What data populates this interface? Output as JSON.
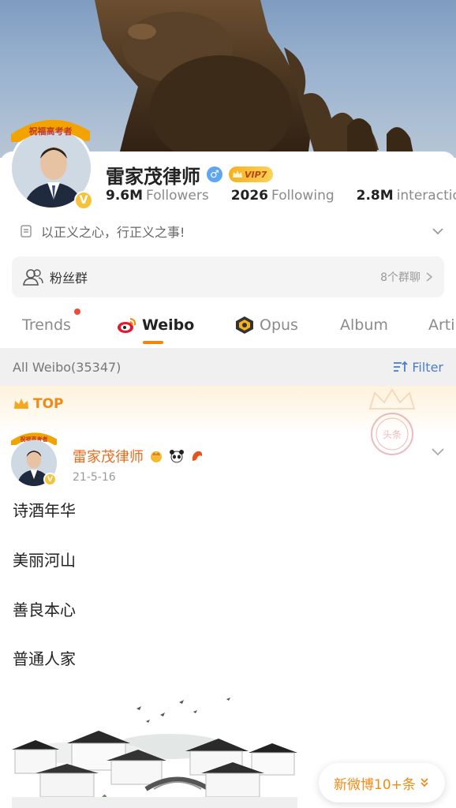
{
  "profile": {
    "name": "雷家茂律师",
    "gender_symbol": "♂",
    "vip_label": "VIP7",
    "verified_badge": "V",
    "avatar_frame_text": "祝福高考者",
    "followers_count": "9.6M",
    "followers_label": "Followers",
    "following_count": "2026",
    "following_label": "Following",
    "interactions_count": "2.8M",
    "interactions_label": "interaction",
    "bio": "以正义之心，行正义之事!"
  },
  "fans_group": {
    "label": "粉丝群",
    "count": "8个群聊"
  },
  "tabs": [
    {
      "label": "Trends"
    },
    {
      "label": "Weibo"
    },
    {
      "label": "Opus"
    },
    {
      "label": "Album"
    },
    {
      "label": "Arti"
    }
  ],
  "filter_bar": {
    "all_weibo": "All Weibo(35347)",
    "filter_label": "Filter"
  },
  "post": {
    "top_label": "TOP",
    "author": "雷家茂律师",
    "date": "21-5-16",
    "seal_text": "头条",
    "lines": [
      "诗酒年华",
      "美丽河山",
      "善良本心",
      "普通人家"
    ]
  },
  "new_posts_button": "新微博10+条",
  "colors": {
    "accent": "#ff8200",
    "link_blue": "#4b7dc8",
    "name_orange": "#e86b1f"
  }
}
